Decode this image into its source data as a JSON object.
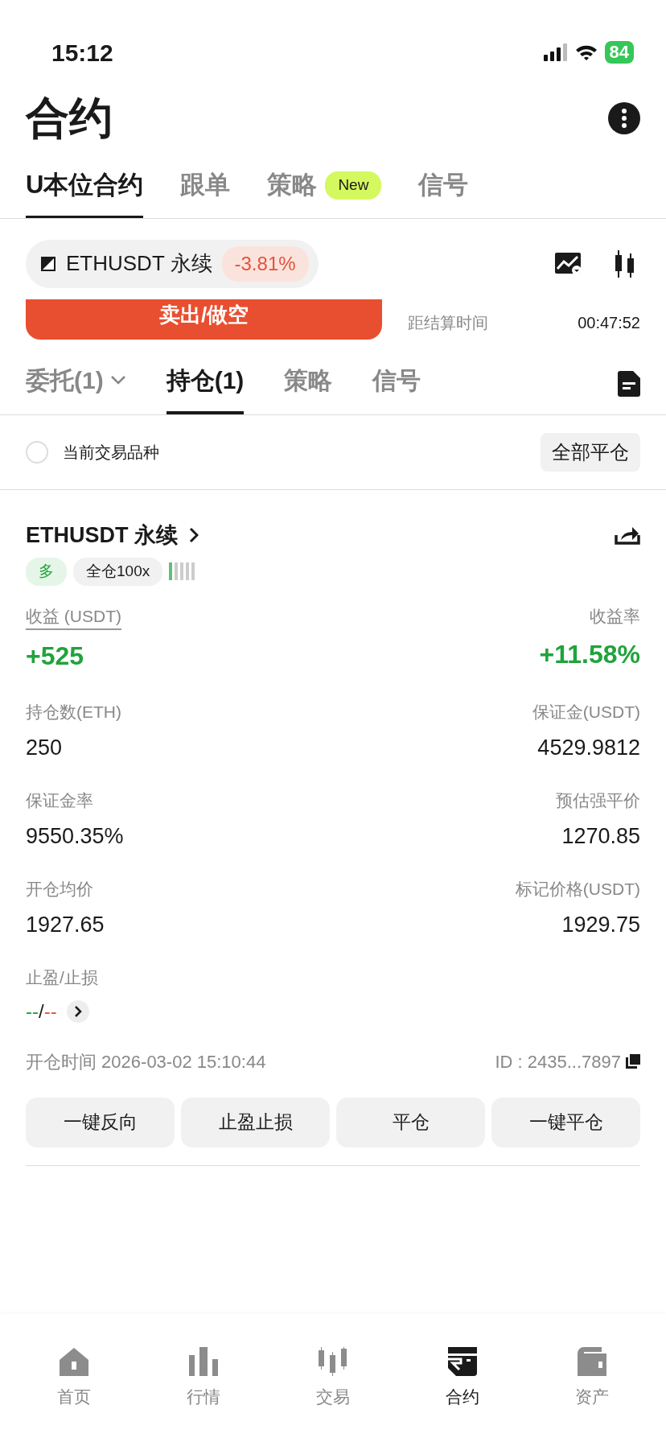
{
  "status_bar": {
    "time": "15:12",
    "battery": "84"
  },
  "header": {
    "title": "合约"
  },
  "tabs": [
    {
      "label": "U本位合约",
      "selected": true
    },
    {
      "label": "跟单",
      "selected": false
    },
    {
      "label": "策略",
      "selected": false,
      "badge": "New"
    },
    {
      "label": "信号",
      "selected": false
    }
  ],
  "symbol": {
    "name": "ETHUSDT 永续",
    "change": "-3.81%"
  },
  "sell_button": "卖出/做空",
  "settlement": {
    "label": "距结算时间",
    "value": "00:47:52"
  },
  "position_tabs": [
    {
      "label": "委托(1)",
      "selected": false,
      "dropdown": true
    },
    {
      "label": "持仓(1)",
      "selected": true
    },
    {
      "label": "策略",
      "selected": false
    },
    {
      "label": "信号",
      "selected": false
    }
  ],
  "filter": {
    "label": "当前交易品种",
    "checked": false,
    "close_all": "全部平仓"
  },
  "position": {
    "symbol": "ETHUSDT 永续",
    "side": "多",
    "mode": "全仓100x",
    "risk": {
      "level": 0.2
    },
    "fields": [
      {
        "label": "收益 (USDT)",
        "value": "+525",
        "kind": "pnl",
        "underlined": true
      },
      {
        "label": "收益率",
        "value": "+11.58%",
        "kind": "pnl"
      },
      {
        "label": "持仓数(ETH)",
        "value": "250",
        "kind": "plain"
      },
      {
        "label": "保证金(USDT)",
        "value": "4529.9812",
        "kind": "plain"
      },
      {
        "label": "保证金率",
        "value": "9550.35%",
        "kind": "plain"
      },
      {
        "label": "预估强平价",
        "value": "1270.85",
        "kind": "plain"
      },
      {
        "label": "开仓均价",
        "value": "1927.65",
        "kind": "plain"
      },
      {
        "label": "标记价格(USDT)",
        "value": "1929.75",
        "kind": "plain"
      }
    ],
    "tpsl": {
      "label": "止盈/止损",
      "take_profit": "--",
      "separator": "/",
      "stop_loss": "--"
    },
    "open_time": "开仓时间 2026-03-02 15:10:44",
    "id": "ID : 2435...7897",
    "actions": [
      "一键反向",
      "止盈止损",
      "平仓",
      "一键平仓"
    ]
  },
  "nav": [
    {
      "label": "首页",
      "kind": "home",
      "selected": false
    },
    {
      "label": "行情",
      "kind": "bars",
      "selected": false
    },
    {
      "label": "交易",
      "kind": "candles",
      "selected": false
    },
    {
      "label": "合约",
      "kind": "contract",
      "selected": true
    },
    {
      "label": "资产",
      "kind": "wallet",
      "selected": false
    }
  ]
}
